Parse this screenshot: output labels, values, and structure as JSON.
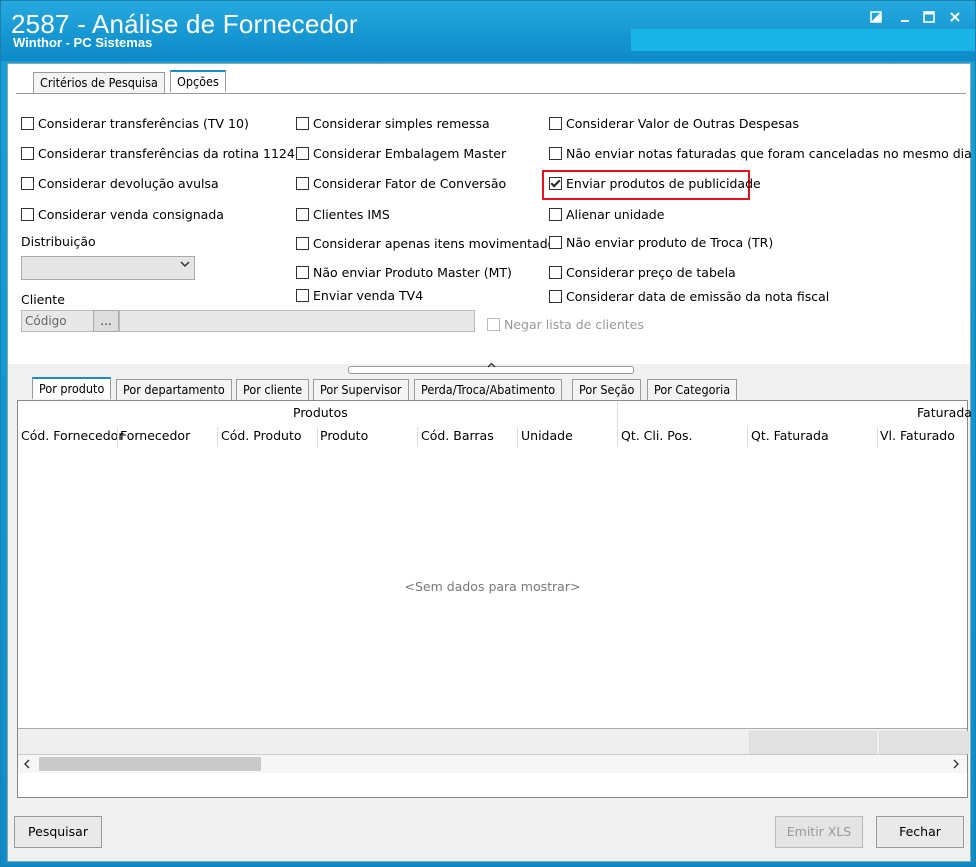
{
  "window": {
    "title": "2587 - Análise de Fornecedor",
    "subtitle": "Winthor - PC Sistemas",
    "controls": [
      "restore",
      "minimize",
      "maximize",
      "close"
    ]
  },
  "top_tabs": [
    {
      "label": "Critérios de Pesquisa",
      "active": false
    },
    {
      "label": "Opções",
      "active": true
    }
  ],
  "options": {
    "col1": [
      {
        "label": "Considerar transferências (TV 10)",
        "checked": false
      },
      {
        "label": "Considerar transferências da rotina 1124",
        "checked": false
      },
      {
        "label": "Considerar devolução avulsa",
        "checked": false
      },
      {
        "label": "Considerar venda consignada",
        "checked": false
      }
    ],
    "col2": [
      {
        "label": "Considerar simples remessa",
        "checked": false
      },
      {
        "label": "Considerar Embalagem Master",
        "checked": false
      },
      {
        "label": "Considerar Fator de Conversão",
        "checked": false
      },
      {
        "label": "Clientes IMS",
        "checked": false
      },
      {
        "label": "Considerar apenas itens movimentados",
        "checked": false
      },
      {
        "label": "Não enviar Produto Master (MT)",
        "checked": false
      },
      {
        "label": "Enviar venda TV4",
        "checked": false
      }
    ],
    "col3": [
      {
        "label": "Considerar Valor de Outras Despesas",
        "checked": false
      },
      {
        "label": "Não enviar notas faturadas que foram canceladas no mesmo dia",
        "checked": false
      },
      {
        "label": "Enviar produtos de publicidade",
        "checked": true
      },
      {
        "label": "Alienar unidade",
        "checked": false
      },
      {
        "label": "Não enviar produto de Troca (TR)",
        "checked": false
      },
      {
        "label": "Considerar preço de tabela",
        "checked": false
      },
      {
        "label": "Considerar data de emissão da nota fiscal",
        "checked": false
      }
    ]
  },
  "distribuicao": {
    "label": "Distribuição",
    "value": ""
  },
  "cliente": {
    "label": "Cliente",
    "code_placeholder": "Código",
    "browse": "...",
    "negar_label": "Negar lista de clientes"
  },
  "bottom_tabs": [
    {
      "label": "Por produto",
      "active": true
    },
    {
      "label": "Por departamento",
      "active": false
    },
    {
      "label": "Por cliente",
      "active": false
    },
    {
      "label": "Por Supervisor",
      "active": false
    },
    {
      "label": "Perda/Troca/Abatimento",
      "active": false
    },
    {
      "label": "Por Seção",
      "active": false
    },
    {
      "label": "Por Categoria",
      "active": false
    }
  ],
  "grid": {
    "band_produtos": "Produtos",
    "band_faturada": "Faturada",
    "columns": [
      "Cód. Fornecedor",
      "Fornecedor",
      "Cód. Produto",
      "Produto",
      "Cód. Barras",
      "Unidade",
      "Qt. Cli. Pos.",
      "Qt. Faturada",
      "Vl. Faturado"
    ],
    "empty": "<Sem dados para mostrar>"
  },
  "buttons": {
    "pesquisar": "Pesquisar",
    "emitir_xls": "Emitir XLS",
    "fechar": "Fechar"
  }
}
